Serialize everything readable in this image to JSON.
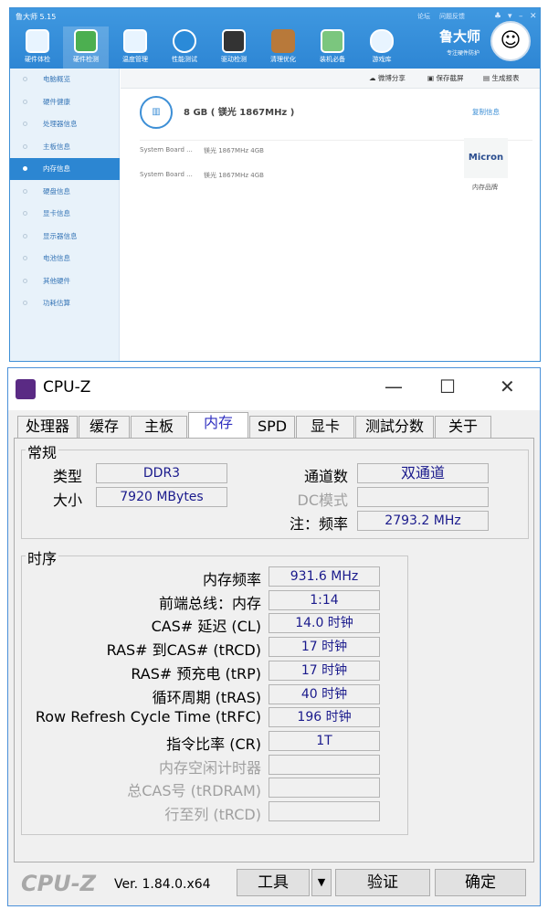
{
  "ludashi": {
    "title": "鲁大师 5.15",
    "top_links": [
      "论坛",
      "问题反馈"
    ],
    "nav": [
      "硬件体检",
      "硬件检测",
      "温度管理",
      "性能测试",
      "驱动检测",
      "清理优化",
      "装机必备",
      "游戏库"
    ],
    "brand": "鲁大师",
    "slogan": "专注硬件防护",
    "sidebar": [
      "电脑概览",
      "硬件健康",
      "处理器信息",
      "主板信息",
      "内存信息",
      "硬盘信息",
      "显卡信息",
      "显示器信息",
      "电池信息",
      "其他硬件",
      "功耗估算"
    ],
    "toolbar": [
      "微博分享",
      "保存截屏",
      "生成报表"
    ],
    "summary": "8 GB ( 镁光 1867MHz )",
    "copy": "复制信息",
    "modules": [
      {
        "slot": "System Board ...",
        "desc": "镁光 1867MHz 4GB"
      },
      {
        "slot": "System Board ...",
        "desc": "镁光 1867MHz 4GB"
      }
    ],
    "brand_logo": "Micron",
    "brand_label": "内存品牌"
  },
  "cpuz": {
    "title": "CPU-Z",
    "tabs": [
      "处理器",
      "缓存",
      "主板",
      "内存",
      "SPD",
      "显卡",
      "测試分数",
      "关于"
    ],
    "general": {
      "label": "常规",
      "type_label": "类型",
      "type": "DDR3",
      "size_label": "大小",
      "size": "7920 MBytes",
      "channels_label": "通道数",
      "channels": "双通道",
      "dc_label": "DC模式",
      "dc": "",
      "freq_label": "注：频率",
      "freq": "2793.2 MHz"
    },
    "timing": {
      "label": "时序",
      "rows": [
        {
          "label": "内存频率",
          "value": "931.6 MHz"
        },
        {
          "label": "前端总线：内存",
          "value": "1:14"
        },
        {
          "label": "CAS# 延迟 (CL)",
          "value": "14.0 时钟"
        },
        {
          "label": "RAS# 到CAS# (tRCD)",
          "value": "17 时钟"
        },
        {
          "label": "RAS# 预充电 (tRP)",
          "value": "17 时钟"
        },
        {
          "label": "循环周期 (tRAS)",
          "value": "40 时钟"
        },
        {
          "label": "Row Refresh Cycle Time (tRFC)",
          "value": "196 时钟"
        },
        {
          "label": "指令比率 (CR)",
          "value": "1T"
        },
        {
          "label": "内存空闲计时器",
          "value": ""
        },
        {
          "label": "总CAS号 (tRDRAM)",
          "value": ""
        },
        {
          "label": "行至列 (tRCD)",
          "value": ""
        }
      ]
    },
    "logo": "CPU-Z",
    "version": "Ver. 1.84.0.x64",
    "tools": "工具",
    "validate": "验证",
    "ok": "确定"
  }
}
